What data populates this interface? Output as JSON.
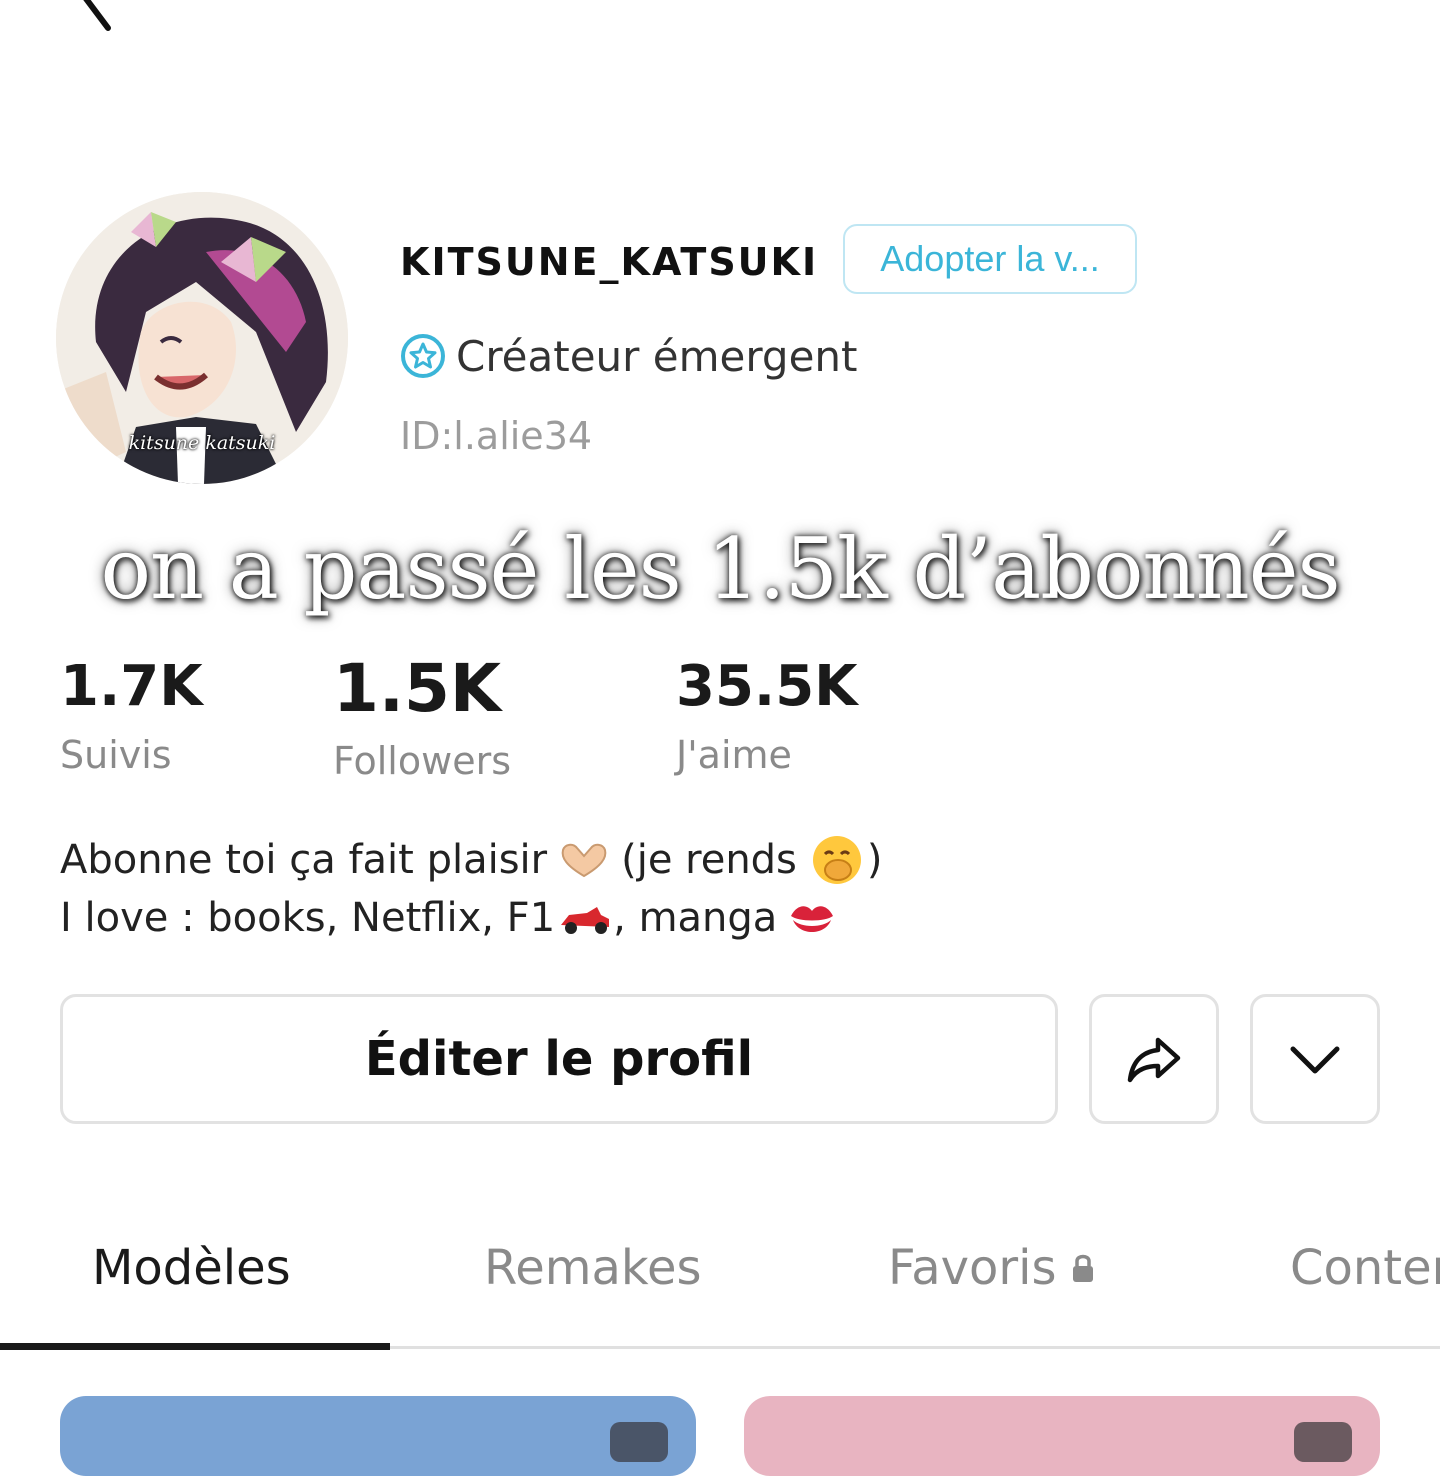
{
  "profile": {
    "username": "KITSUNE_KATSUKI",
    "adopt_button": "Adopter la v...",
    "creator_label": "Créateur émergent",
    "user_id": "ID:l.alie34",
    "avatar_caption": "kitsune katsuki"
  },
  "overlay": {
    "text": "on a passé les 1.5k d’abonnés"
  },
  "stats": {
    "following": {
      "value": "1.7K",
      "label": "Suivis"
    },
    "followers": {
      "value": "1.5K",
      "label": "Followers"
    },
    "likes": {
      "value": "35.5K",
      "label": "J'aime"
    }
  },
  "bio": {
    "line1_a": "Abonne toi ça fait plaisir",
    "line1_b": "(je rends",
    "line1_c": ")",
    "line2_a": "I love : books, Netflix, F1",
    "line2_b": ", manga"
  },
  "actions": {
    "edit_profile": "Éditer le profil"
  },
  "tabs": [
    "Modèles",
    "Remakes",
    "Favoris",
    "Conter"
  ],
  "icons": {
    "back": "back-arrow-icon",
    "creator": "star-badge-icon",
    "share": "share-arrow-icon",
    "more": "chevron-down-icon",
    "lock": "lock-icon"
  },
  "colors": {
    "accent_blue": "#3bb5d8",
    "card_blue": "#7aa3d4",
    "card_pink": "#e8b4c1"
  }
}
